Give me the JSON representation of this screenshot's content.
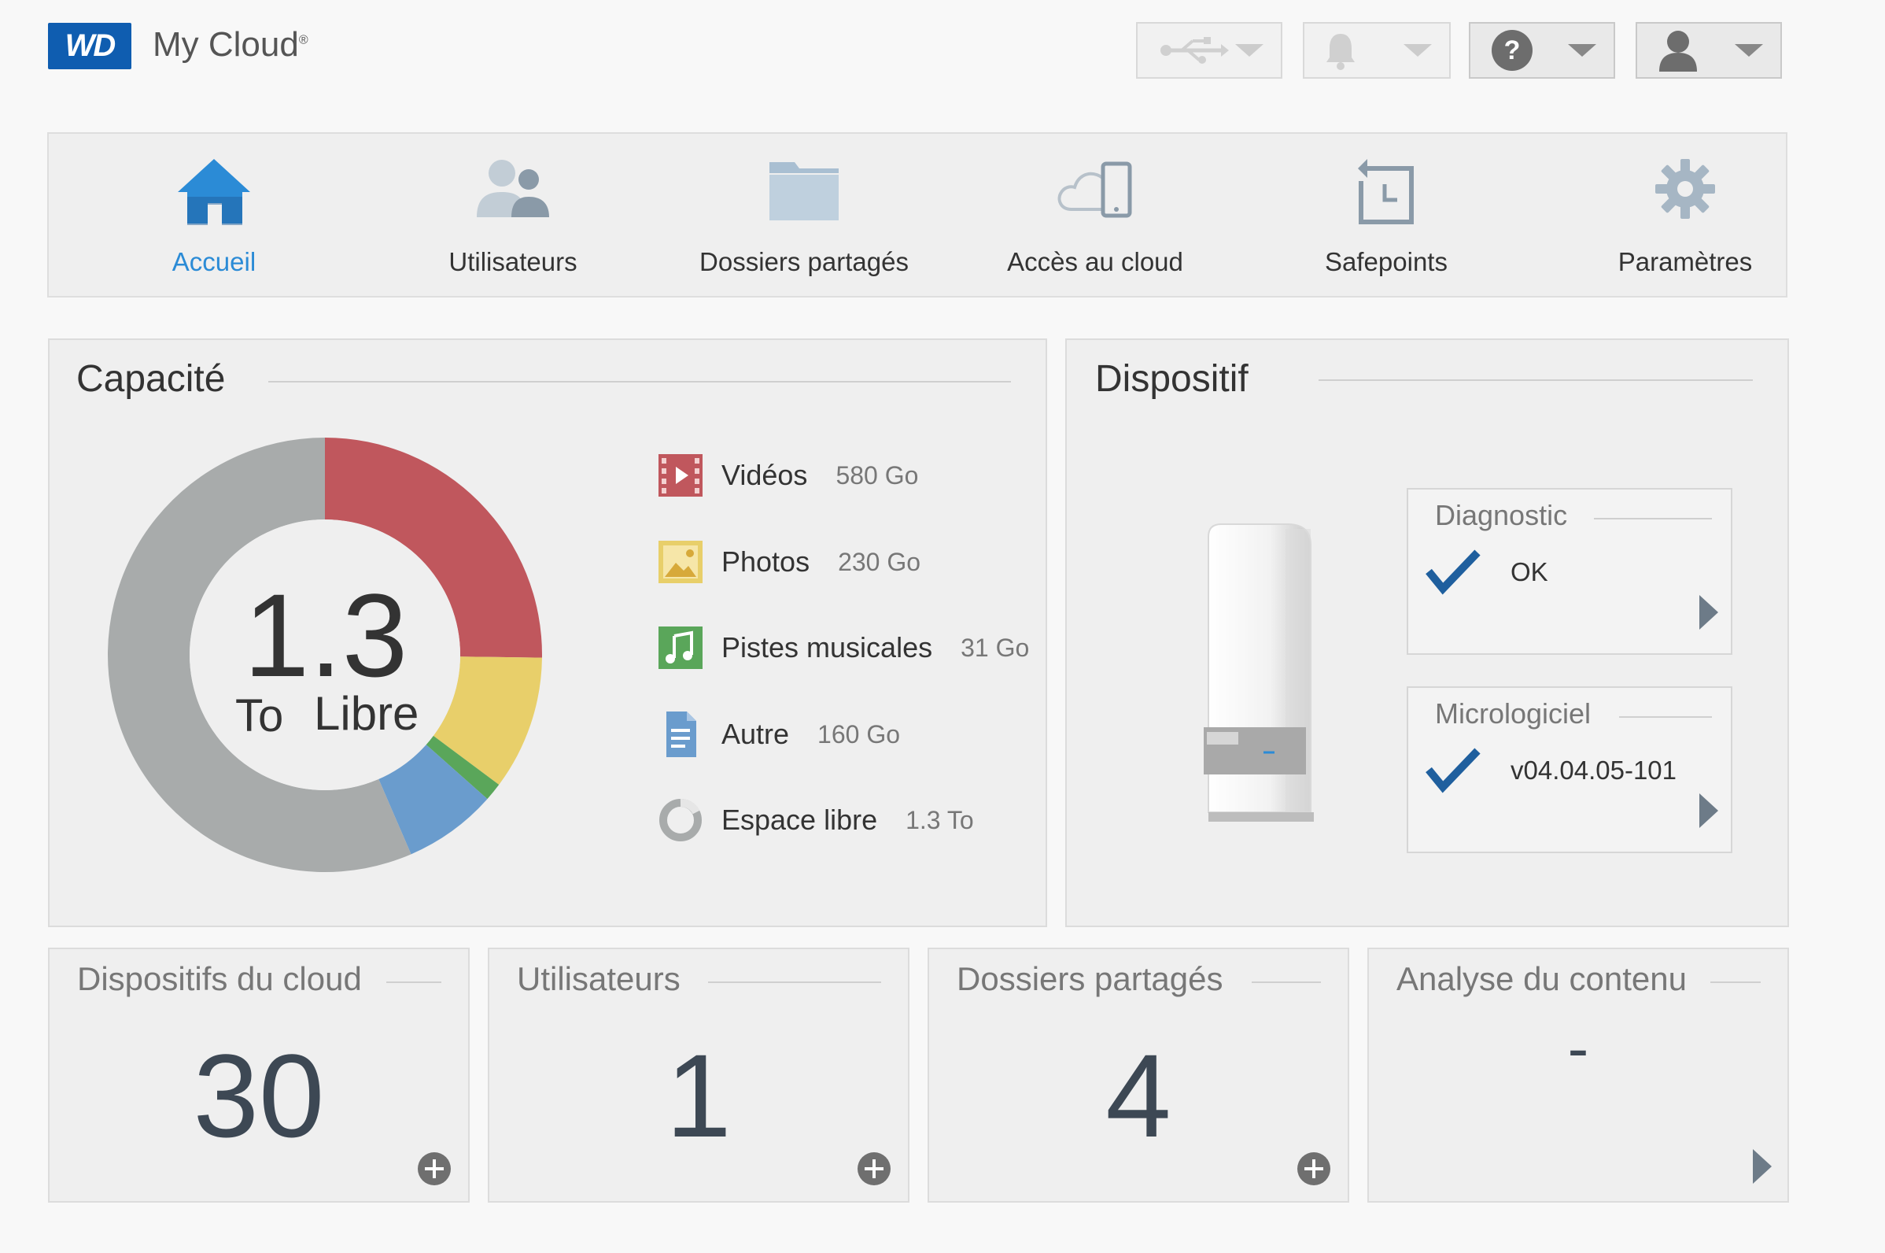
{
  "header": {
    "logo": "WD",
    "app_name": "My Cloud",
    "trademark": "®"
  },
  "nav": {
    "items": [
      {
        "label": "Accueil",
        "icon": "home-icon",
        "active": true
      },
      {
        "label": "Utilisateurs",
        "icon": "users-icon"
      },
      {
        "label": "Dossiers partagés",
        "icon": "folder-icon"
      },
      {
        "label": "Accès au cloud",
        "icon": "cloud-device-icon"
      },
      {
        "label": "Safepoints",
        "icon": "safepoint-icon"
      },
      {
        "label": "Paramètres",
        "icon": "gear-icon"
      }
    ]
  },
  "capacity": {
    "title": "Capacité",
    "center_value": "1.3",
    "center_unit": "To",
    "center_label": "Libre",
    "legend": [
      {
        "name": "Vidéos",
        "value": "580 Go",
        "icon": "video-icon"
      },
      {
        "name": "Photos",
        "value": "230 Go",
        "icon": "photo-icon"
      },
      {
        "name": "Pistes musicales",
        "value": "31 Go",
        "icon": "music-icon"
      },
      {
        "name": "Autre",
        "value": "160 Go",
        "icon": "document-icon"
      },
      {
        "name": "Espace libre",
        "value": "1.3 To",
        "icon": "free-space-icon"
      }
    ],
    "colors": {
      "videos": "#c0575d",
      "photos": "#e8cf6a",
      "music": "#5aa65a",
      "other": "#6a9ccd",
      "free": "#a8abab"
    },
    "chart_data": {
      "type": "pie",
      "categories": [
        "Vidéos",
        "Photos",
        "Pistes musicales",
        "Autre",
        "Espace libre"
      ],
      "values": [
        580,
        230,
        31,
        160,
        1300
      ]
    }
  },
  "device": {
    "title": "Dispositif",
    "diagnostic": {
      "title": "Diagnostic",
      "value": "OK"
    },
    "firmware": {
      "title": "Micrologiciel",
      "value": "v04.04.05-101"
    }
  },
  "tiles": [
    {
      "title": "Dispositifs du cloud",
      "value": "30",
      "action": "add"
    },
    {
      "title": "Utilisateurs",
      "value": "1",
      "action": "add"
    },
    {
      "title": "Dossiers partagés",
      "value": "4",
      "action": "add"
    },
    {
      "title": "Analyse du contenu",
      "value": "-",
      "action": "arrow"
    }
  ]
}
